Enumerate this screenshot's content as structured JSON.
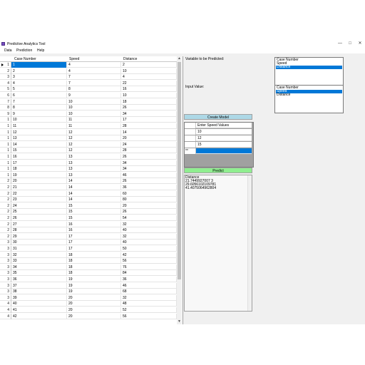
{
  "window": {
    "title": "Predictive Analytics Tool",
    "controls": {
      "minimize": "—",
      "maximize": "□",
      "close": "✕"
    }
  },
  "menu": [
    "Data",
    "Prediction",
    "Help"
  ],
  "grid": {
    "columns": [
      "Case Number",
      "Speed",
      "Distance"
    ],
    "rows": [
      [
        "1",
        "1",
        "4",
        "2"
      ],
      [
        "2",
        "2",
        "4",
        "10"
      ],
      [
        "3",
        "3",
        "7",
        "4"
      ],
      [
        "4",
        "4",
        "7",
        "22"
      ],
      [
        "5",
        "5",
        "8",
        "16"
      ],
      [
        "6",
        "6",
        "9",
        "10"
      ],
      [
        "7",
        "7",
        "10",
        "18"
      ],
      [
        "8",
        "8",
        "10",
        "26"
      ],
      [
        "9",
        "9",
        "10",
        "34"
      ],
      [
        "1",
        "10",
        "11",
        "17"
      ],
      [
        "1",
        "11",
        "11",
        "28"
      ],
      [
        "1",
        "12",
        "12",
        "14"
      ],
      [
        "1",
        "13",
        "12",
        "20"
      ],
      [
        "1",
        "14",
        "12",
        "24"
      ],
      [
        "1",
        "15",
        "12",
        "28"
      ],
      [
        "1",
        "16",
        "13",
        "26"
      ],
      [
        "1",
        "17",
        "13",
        "34"
      ],
      [
        "1",
        "18",
        "13",
        "34"
      ],
      [
        "1",
        "19",
        "13",
        "46"
      ],
      [
        "2",
        "20",
        "14",
        "26"
      ],
      [
        "2",
        "21",
        "14",
        "36"
      ],
      [
        "2",
        "22",
        "14",
        "60"
      ],
      [
        "2",
        "23",
        "14",
        "80"
      ],
      [
        "2",
        "24",
        "15",
        "20"
      ],
      [
        "2",
        "25",
        "15",
        "26"
      ],
      [
        "2",
        "26",
        "15",
        "54"
      ],
      [
        "2",
        "27",
        "16",
        "32"
      ],
      [
        "2",
        "28",
        "16",
        "40"
      ],
      [
        "2",
        "29",
        "17",
        "32"
      ],
      [
        "3",
        "30",
        "17",
        "40"
      ],
      [
        "3",
        "31",
        "17",
        "50"
      ],
      [
        "3",
        "32",
        "18",
        "42"
      ],
      [
        "3",
        "33",
        "18",
        "56"
      ],
      [
        "3",
        "34",
        "18",
        "76"
      ],
      [
        "3",
        "35",
        "18",
        "84"
      ],
      [
        "3",
        "36",
        "19",
        "36"
      ],
      [
        "3",
        "37",
        "19",
        "46"
      ],
      [
        "3",
        "38",
        "19",
        "68"
      ],
      [
        "3",
        "39",
        "20",
        "32"
      ],
      [
        "4",
        "40",
        "20",
        "48"
      ],
      [
        "4",
        "41",
        "20",
        "52"
      ],
      [
        "4",
        "42",
        "20",
        "56"
      ]
    ]
  },
  "target": {
    "label": "Variable to be Predicted:",
    "options": [
      "Case Number",
      "Speed",
      "Distance"
    ],
    "selected": "Distance"
  },
  "input": {
    "label": "Input Value:",
    "options": [
      "Case Number",
      "Speed",
      "Distance"
    ],
    "selected": "Speed"
  },
  "create_model_label": "Create Model",
  "speed_grid": {
    "header": "Enter Speed Values",
    "values": [
      "10",
      "12",
      "15"
    ],
    "new_row_marker": "**"
  },
  "predict_label": "Predict",
  "results": {
    "lines": [
      "Distance",
      "21.7449927007 3",
      "29.6056102109781",
      "41.4075064962804"
    ]
  },
  "colors": {
    "selection": "#0078d7",
    "create_button": "#add8e6",
    "predict_button": "#90ee90"
  }
}
